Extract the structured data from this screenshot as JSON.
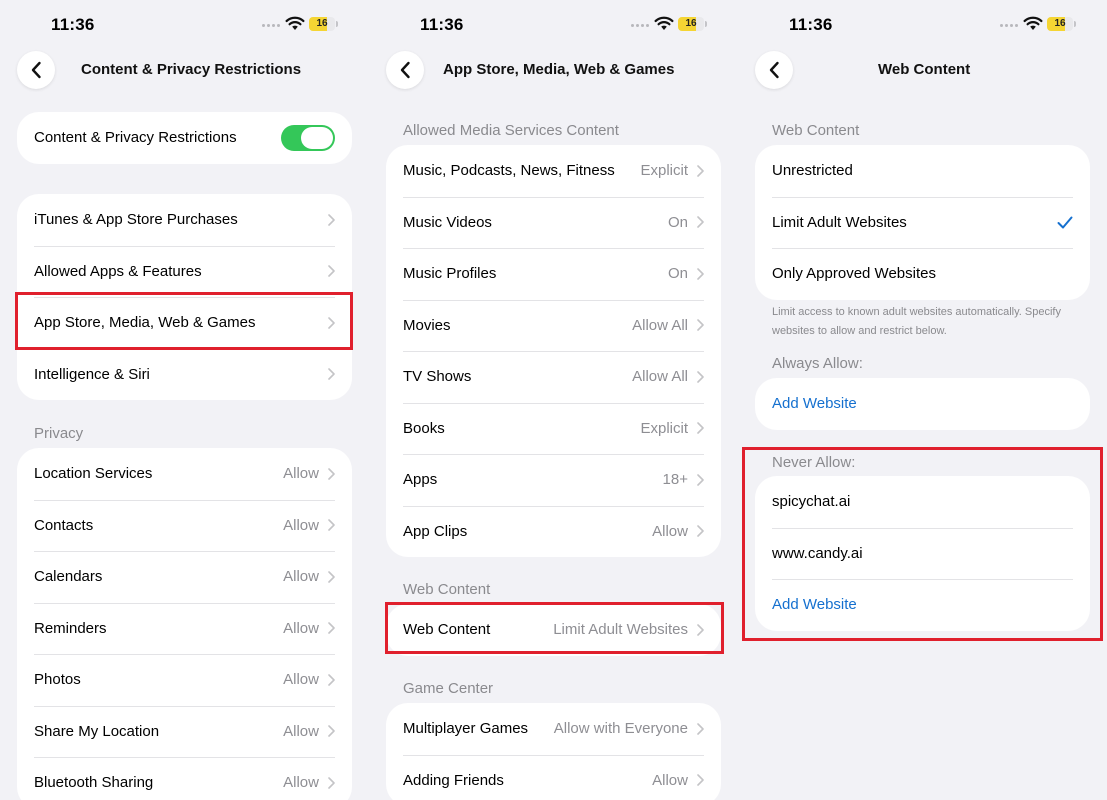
{
  "status_bar": {
    "time": "11:36",
    "battery": "16"
  },
  "screen1": {
    "title": "Content & Privacy Restrictions",
    "toggle_row": {
      "label": "Content & Privacy Restrictions",
      "enabled": true
    },
    "menu": [
      {
        "label": "iTunes & App Store Purchases"
      },
      {
        "label": "Allowed Apps & Features"
      },
      {
        "label": "App Store, Media, Web & Games"
      },
      {
        "label": "Intelligence & Siri"
      }
    ],
    "privacy_header": "Privacy",
    "privacy": [
      {
        "label": "Location Services",
        "value": "Allow"
      },
      {
        "label": "Contacts",
        "value": "Allow"
      },
      {
        "label": "Calendars",
        "value": "Allow"
      },
      {
        "label": "Reminders",
        "value": "Allow"
      },
      {
        "label": "Photos",
        "value": "Allow"
      },
      {
        "label": "Share My Location",
        "value": "Allow"
      },
      {
        "label": "Bluetooth Sharing",
        "value": "Allow"
      }
    ]
  },
  "screen2": {
    "title": "App Store, Media, Web & Games",
    "media_header": "Allowed Media Services Content",
    "media": [
      {
        "label": "Music, Podcasts, News, Fitness",
        "value": "Explicit"
      },
      {
        "label": "Music Videos",
        "value": "On"
      },
      {
        "label": "Music Profiles",
        "value": "On"
      },
      {
        "label": "Movies",
        "value": "Allow All"
      },
      {
        "label": "TV Shows",
        "value": "Allow All"
      },
      {
        "label": "Books",
        "value": "Explicit"
      },
      {
        "label": "Apps",
        "value": "18+"
      },
      {
        "label": "App Clips",
        "value": "Allow"
      }
    ],
    "web_header": "Web Content",
    "web": {
      "label": "Web Content",
      "value": "Limit Adult Websites"
    },
    "game_header": "Game Center",
    "game": [
      {
        "label": "Multiplayer Games",
        "value": "Allow with Everyone"
      },
      {
        "label": "Adding Friends",
        "value": "Allow"
      }
    ]
  },
  "screen3": {
    "title": "Web Content",
    "header": "Web Content",
    "options": [
      {
        "label": "Unrestricted",
        "selected": false
      },
      {
        "label": "Limit Adult Websites",
        "selected": true
      },
      {
        "label": "Only Approved Websites",
        "selected": false
      }
    ],
    "footnote": "Limit access to known adult websites automatically. Specify websites to allow and restrict below.",
    "always_allow_header": "Always Allow:",
    "always_allow_add": "Add Website",
    "never_allow_header": "Never Allow:",
    "never_allow": [
      {
        "label": "spicychat.ai"
      },
      {
        "label": "www.candy.ai"
      }
    ],
    "never_allow_add": "Add Website"
  },
  "colors": {
    "accent": "#1570cf",
    "toggle_on": "#34c759",
    "highlight": "#e0202d",
    "background": "#f2f2f6"
  }
}
